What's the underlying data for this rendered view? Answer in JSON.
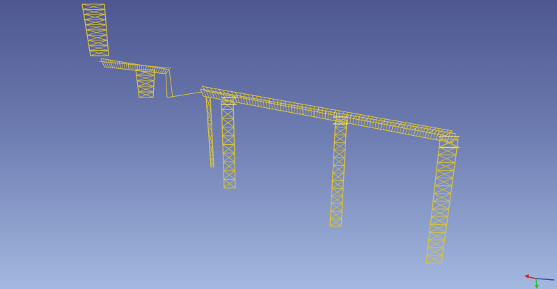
{
  "view": {
    "background_top": "#4e5791",
    "background_bottom": "#a3b8df"
  },
  "model": {
    "member_color": "#d9c23a",
    "member_highlight": "#f3e08a"
  },
  "axis_indicator": {
    "x_color": "#e0241b",
    "z_color": "#2fbf2f",
    "y_color": "#2846c8"
  }
}
